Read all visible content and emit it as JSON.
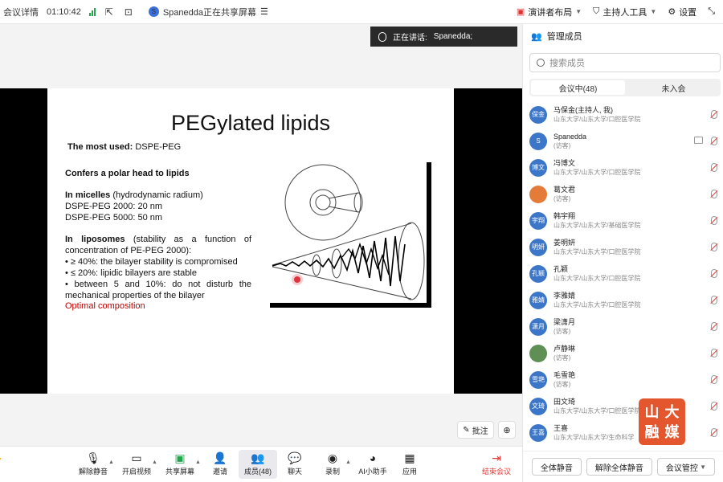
{
  "topbar": {
    "meeting_details": "会议详情",
    "timer": "01:10:42",
    "sharer_initial": "S",
    "sharing_text": "Spanedda正在共享屏幕",
    "layout": "演讲者布局",
    "host_tools": "主持人工具",
    "settings": "设置"
  },
  "speaking": {
    "label": "正在讲话:",
    "name": "Spanedda;"
  },
  "slide": {
    "title": "PEGylated lipids",
    "most_used_label": "The most used:",
    "most_used_value": " DSPE-PEG",
    "polar_head": "Confers a polar head to lipids",
    "micelles_label": "In micelles",
    "micelles_rest": " (hydrodynamic radium)",
    "dspe2000": "DSPE-PEG 2000: 20 nm",
    "dspe5000": "DSPE-PEG 5000: 50 nm",
    "liposomes_label": "In liposomes",
    "liposomes_rest": " (stability as a function of concentration of PE-PEG 2000):",
    "bullet1": "• ≥ 40%: the bilayer stability is compromised",
    "bullet2": "• ≤ 20%: lipidic bilayers are stable",
    "bullet3": "• between 5 and 10%: do not disturb the mechanical properties of the bilayer",
    "optimal": "Optimal composition"
  },
  "stage_tools": {
    "annotate": "批注"
  },
  "toolbar": {
    "unmute": "解除静音",
    "video": "开启视频",
    "share": "共享屏幕",
    "invite": "邀请",
    "members": "成员(48)",
    "chat": "聊天",
    "record": "录制",
    "ai": "AI小助手",
    "apps": "应用",
    "end": "结束会议"
  },
  "panel": {
    "title": "管理成员",
    "search_placeholder": "搜索成员",
    "tab_in": "会议中(48)",
    "tab_out": "未入会",
    "members": [
      {
        "avatar": "保金",
        "name": "马保金(主持人, 我)",
        "sub": "山东大学/山东大学/口腔医学院"
      },
      {
        "avatar": "S",
        "name": "Spanedda",
        "sub": "(访客)"
      },
      {
        "avatar": "博文",
        "name": "冯博文",
        "sub": "山东大学/山东大学/口腔医学院"
      },
      {
        "avatar": "",
        "name": "葛文君",
        "sub": "(访客)"
      },
      {
        "avatar": "宇翔",
        "name": "韩宇翔",
        "sub": "山东大学/山东大学/基础医学院"
      },
      {
        "avatar": "明妍",
        "name": "姜明妍",
        "sub": "山东大学/山东大学/口腔医学院"
      },
      {
        "avatar": "孔颖",
        "name": "孔颖",
        "sub": "山东大学/山东大学/口腔医学院"
      },
      {
        "avatar": "雅婧",
        "name": "李雅婧",
        "sub": "山东大学/山东大学/口腔医学院"
      },
      {
        "avatar": "潇月",
        "name": "梁潇月",
        "sub": "(访客)"
      },
      {
        "avatar": "",
        "name": "卢静琳",
        "sub": "(访客)"
      },
      {
        "avatar": "雪艳",
        "name": "毛雪艳",
        "sub": "(访客)"
      },
      {
        "avatar": "文琦",
        "name": "田文琦",
        "sub": "山东大学/山东大学/口腔医学院"
      },
      {
        "avatar": "王喜",
        "name": "王喜",
        "sub": "山东大学/山东大学/生命科学"
      }
    ],
    "mute_all": "全体静音",
    "unmute_all": "解除全体静音",
    "control": "会议管控"
  },
  "logo": [
    "山",
    "大",
    "融",
    "媒"
  ],
  "colors": {
    "accent": "#3b76c8",
    "end_red": "#e53935",
    "signal_green": "#21a64b"
  }
}
